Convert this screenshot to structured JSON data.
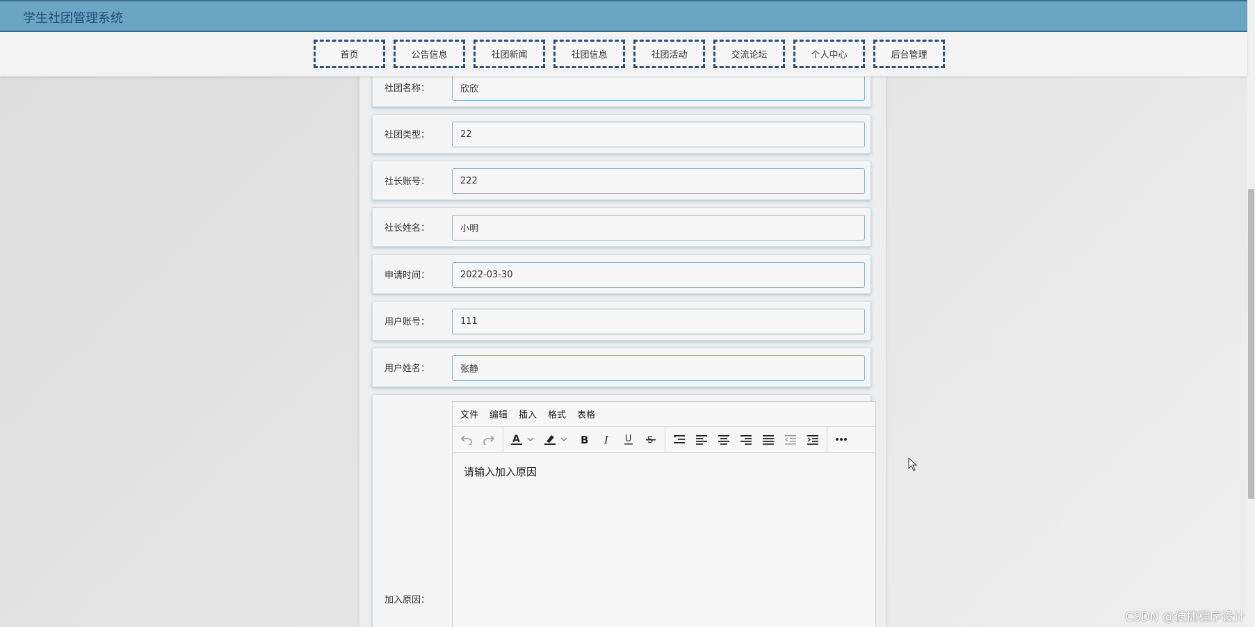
{
  "app": {
    "title": "学生社团管理系统"
  },
  "nav": {
    "items": [
      {
        "label": "首页",
        "width": 103
      },
      {
        "label": "公告信息",
        "width": 103
      },
      {
        "label": "社团新闻",
        "width": 103
      },
      {
        "label": "社团信息",
        "width": 103
      },
      {
        "label": "社团活动",
        "width": 103
      },
      {
        "label": "交流论坛",
        "width": 103
      },
      {
        "label": "个人中心",
        "width": 103
      },
      {
        "label": "后台管理",
        "width": 103
      }
    ]
  },
  "form": {
    "fields": [
      {
        "label": "社团名称：",
        "value": "欣欣"
      },
      {
        "label": "社团类型：",
        "value": "22"
      },
      {
        "label": "社长账号：",
        "value": "222"
      },
      {
        "label": "社长姓名：",
        "value": "小明"
      },
      {
        "label": "申请时间：",
        "value": "2022-03-30"
      },
      {
        "label": "用户账号：",
        "value": "111"
      },
      {
        "label": "用户姓名：",
        "value": "张静"
      }
    ],
    "reason": {
      "label": "加入原因：",
      "placeholder": "请输入加入原因"
    }
  },
  "editor": {
    "menus": [
      "文件",
      "编辑",
      "插入",
      "格式",
      "表格"
    ],
    "toolbar": [
      [
        "undo-icon",
        "redo-icon"
      ],
      [
        "text-color-icon",
        "highlight-icon",
        "bold-icon",
        "italic-icon",
        "underline-icon",
        "strikethrough-icon"
      ],
      [
        "line-height-icon",
        "align-left-icon",
        "align-center-icon",
        "align-right-icon",
        "align-justify-icon",
        "outdent-icon",
        "indent-icon"
      ],
      [
        "more-icon"
      ]
    ]
  },
  "watermark": "CSDN @便捷程序设计",
  "colors": {
    "topbar": "#6aa6c3",
    "title": "#1f4f7a",
    "nav_border": "#2d4f7c"
  }
}
